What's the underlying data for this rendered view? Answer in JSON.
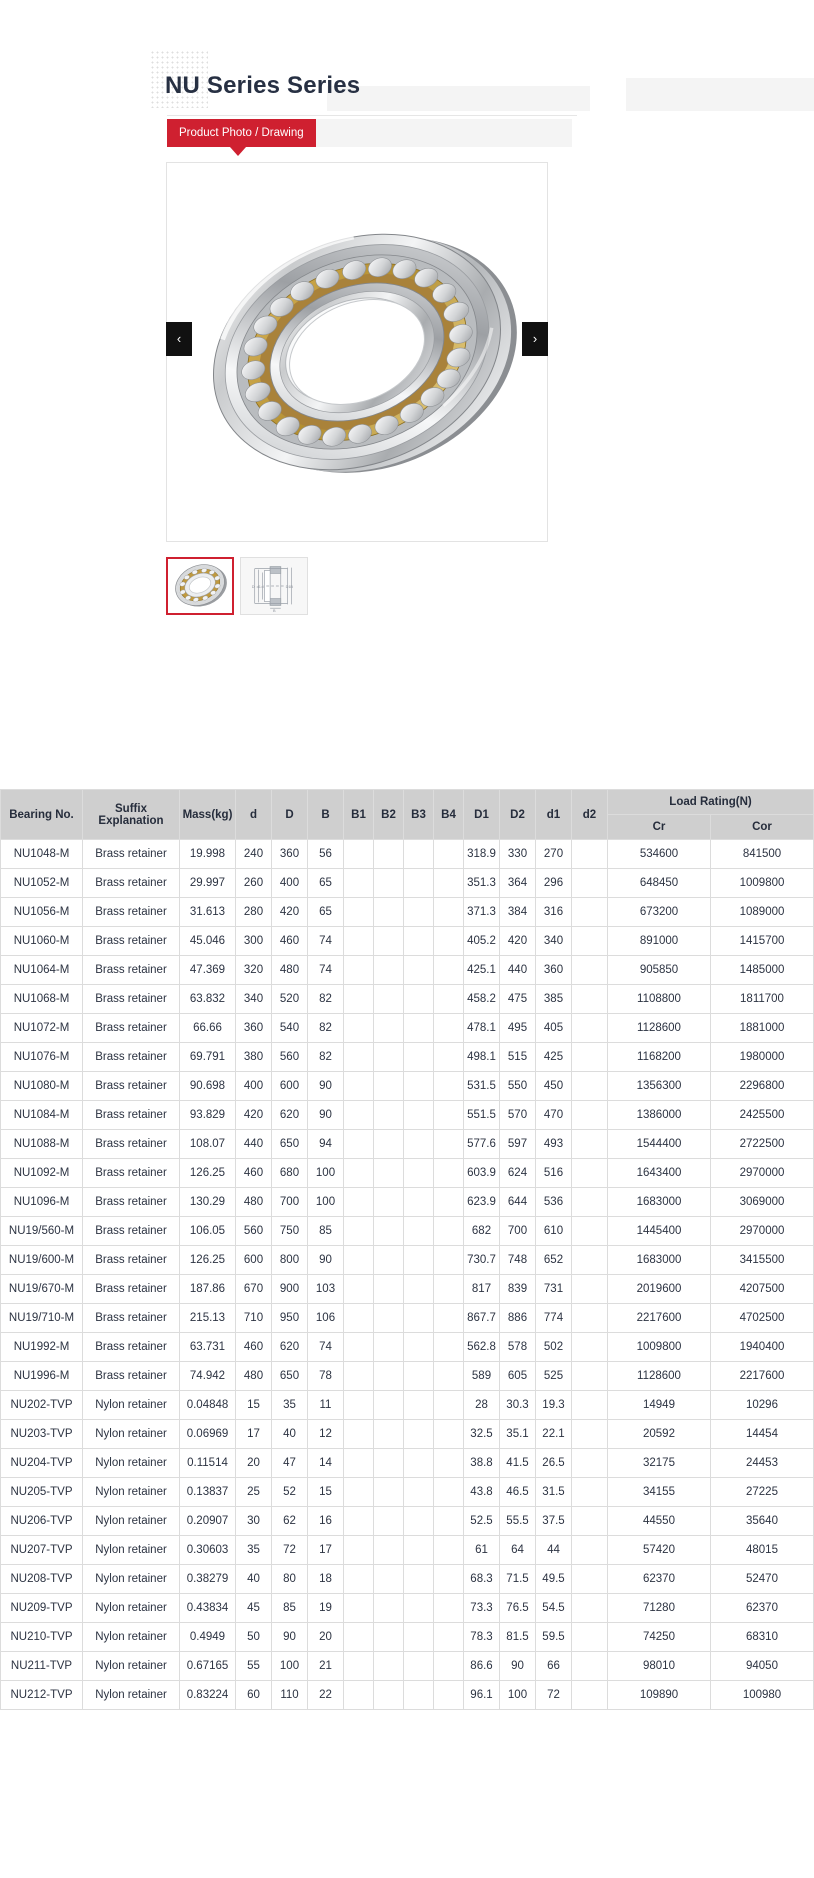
{
  "header": {
    "title": "NU Series Series",
    "tab_label": "Product Photo / Drawing"
  },
  "gallery": {
    "prev_label": "‹",
    "next_label": "›",
    "thumbs": [
      {
        "name": "product-photo-thumbnail",
        "selected": true
      },
      {
        "name": "technical-drawing-thumbnail",
        "selected": false
      }
    ]
  },
  "colors": {
    "accent": "#cf2030",
    "header_bg": "#cfcfcf",
    "text": "#2c3342",
    "border": "#dcdcdc"
  },
  "table": {
    "group_header": "Load Rating(N)",
    "columns": [
      "Bearing No.",
      "Suffix Explanation",
      "Mass(kg)",
      "d",
      "D",
      "B",
      "B1",
      "B2",
      "B3",
      "B4",
      "D1",
      "D2",
      "d1",
      "d2"
    ],
    "load_columns": [
      "Cr",
      "Cor"
    ],
    "rows": [
      [
        "NU1048-M",
        "Brass retainer",
        "19.998",
        "240",
        "360",
        "56",
        "",
        "",
        "",
        "",
        "318.9",
        "330",
        "270",
        "",
        "534600",
        "841500"
      ],
      [
        "NU1052-M",
        "Brass retainer",
        "29.997",
        "260",
        "400",
        "65",
        "",
        "",
        "",
        "",
        "351.3",
        "364",
        "296",
        "",
        "648450",
        "1009800"
      ],
      [
        "NU1056-M",
        "Brass retainer",
        "31.613",
        "280",
        "420",
        "65",
        "",
        "",
        "",
        "",
        "371.3",
        "384",
        "316",
        "",
        "673200",
        "1089000"
      ],
      [
        "NU1060-M",
        "Brass retainer",
        "45.046",
        "300",
        "460",
        "74",
        "",
        "",
        "",
        "",
        "405.2",
        "420",
        "340",
        "",
        "891000",
        "1415700"
      ],
      [
        "NU1064-M",
        "Brass retainer",
        "47.369",
        "320",
        "480",
        "74",
        "",
        "",
        "",
        "",
        "425.1",
        "440",
        "360",
        "",
        "905850",
        "1485000"
      ],
      [
        "NU1068-M",
        "Brass retainer",
        "63.832",
        "340",
        "520",
        "82",
        "",
        "",
        "",
        "",
        "458.2",
        "475",
        "385",
        "",
        "1108800",
        "1811700"
      ],
      [
        "NU1072-M",
        "Brass retainer",
        "66.66",
        "360",
        "540",
        "82",
        "",
        "",
        "",
        "",
        "478.1",
        "495",
        "405",
        "",
        "1128600",
        "1881000"
      ],
      [
        "NU1076-M",
        "Brass retainer",
        "69.791",
        "380",
        "560",
        "82",
        "",
        "",
        "",
        "",
        "498.1",
        "515",
        "425",
        "",
        "1168200",
        "1980000"
      ],
      [
        "NU1080-M",
        "Brass retainer",
        "90.698",
        "400",
        "600",
        "90",
        "",
        "",
        "",
        "",
        "531.5",
        "550",
        "450",
        "",
        "1356300",
        "2296800"
      ],
      [
        "NU1084-M",
        "Brass retainer",
        "93.829",
        "420",
        "620",
        "90",
        "",
        "",
        "",
        "",
        "551.5",
        "570",
        "470",
        "",
        "1386000",
        "2425500"
      ],
      [
        "NU1088-M",
        "Brass retainer",
        "108.07",
        "440",
        "650",
        "94",
        "",
        "",
        "",
        "",
        "577.6",
        "597",
        "493",
        "",
        "1544400",
        "2722500"
      ],
      [
        "NU1092-M",
        "Brass retainer",
        "126.25",
        "460",
        "680",
        "100",
        "",
        "",
        "",
        "",
        "603.9",
        "624",
        "516",
        "",
        "1643400",
        "2970000"
      ],
      [
        "NU1096-M",
        "Brass retainer",
        "130.29",
        "480",
        "700",
        "100",
        "",
        "",
        "",
        "",
        "623.9",
        "644",
        "536",
        "",
        "1683000",
        "3069000"
      ],
      [
        "NU19/560-M",
        "Brass retainer",
        "106.05",
        "560",
        "750",
        "85",
        "",
        "",
        "",
        "",
        "682",
        "700",
        "610",
        "",
        "1445400",
        "2970000"
      ],
      [
        "NU19/600-M",
        "Brass retainer",
        "126.25",
        "600",
        "800",
        "90",
        "",
        "",
        "",
        "",
        "730.7",
        "748",
        "652",
        "",
        "1683000",
        "3415500"
      ],
      [
        "NU19/670-M",
        "Brass retainer",
        "187.86",
        "670",
        "900",
        "103",
        "",
        "",
        "",
        "",
        "817",
        "839",
        "731",
        "",
        "2019600",
        "4207500"
      ],
      [
        "NU19/710-M",
        "Brass retainer",
        "215.13",
        "710",
        "950",
        "106",
        "",
        "",
        "",
        "",
        "867.7",
        "886",
        "774",
        "",
        "2217600",
        "4702500"
      ],
      [
        "NU1992-M",
        "Brass retainer",
        "63.731",
        "460",
        "620",
        "74",
        "",
        "",
        "",
        "",
        "562.8",
        "578",
        "502",
        "",
        "1009800",
        "1940400"
      ],
      [
        "NU1996-M",
        "Brass retainer",
        "74.942",
        "480",
        "650",
        "78",
        "",
        "",
        "",
        "",
        "589",
        "605",
        "525",
        "",
        "1128600",
        "2217600"
      ],
      [
        "NU202-TVP",
        "Nylon retainer",
        "0.04848",
        "15",
        "35",
        "11",
        "",
        "",
        "",
        "",
        "28",
        "30.3",
        "19.3",
        "",
        "14949",
        "10296"
      ],
      [
        "NU203-TVP",
        "Nylon retainer",
        "0.06969",
        "17",
        "40",
        "12",
        "",
        "",
        "",
        "",
        "32.5",
        "35.1",
        "22.1",
        "",
        "20592",
        "14454"
      ],
      [
        "NU204-TVP",
        "Nylon retainer",
        "0.11514",
        "20",
        "47",
        "14",
        "",
        "",
        "",
        "",
        "38.8",
        "41.5",
        "26.5",
        "",
        "32175",
        "24453"
      ],
      [
        "NU205-TVP",
        "Nylon retainer",
        "0.13837",
        "25",
        "52",
        "15",
        "",
        "",
        "",
        "",
        "43.8",
        "46.5",
        "31.5",
        "",
        "34155",
        "27225"
      ],
      [
        "NU206-TVP",
        "Nylon retainer",
        "0.20907",
        "30",
        "62",
        "16",
        "",
        "",
        "",
        "",
        "52.5",
        "55.5",
        "37.5",
        "",
        "44550",
        "35640"
      ],
      [
        "NU207-TVP",
        "Nylon retainer",
        "0.30603",
        "35",
        "72",
        "17",
        "",
        "",
        "",
        "",
        "61",
        "64",
        "44",
        "",
        "57420",
        "48015"
      ],
      [
        "NU208-TVP",
        "Nylon retainer",
        "0.38279",
        "40",
        "80",
        "18",
        "",
        "",
        "",
        "",
        "68.3",
        "71.5",
        "49.5",
        "",
        "62370",
        "52470"
      ],
      [
        "NU209-TVP",
        "Nylon retainer",
        "0.43834",
        "45",
        "85",
        "19",
        "",
        "",
        "",
        "",
        "73.3",
        "76.5",
        "54.5",
        "",
        "71280",
        "62370"
      ],
      [
        "NU210-TVP",
        "Nylon retainer",
        "0.4949",
        "50",
        "90",
        "20",
        "",
        "",
        "",
        "",
        "78.3",
        "81.5",
        "59.5",
        "",
        "74250",
        "68310"
      ],
      [
        "NU211-TVP",
        "Nylon retainer",
        "0.67165",
        "55",
        "100",
        "21",
        "",
        "",
        "",
        "",
        "86.6",
        "90",
        "66",
        "",
        "98010",
        "94050"
      ],
      [
        "NU212-TVP",
        "Nylon retainer",
        "0.83224",
        "60",
        "110",
        "22",
        "",
        "",
        "",
        "",
        "96.1",
        "100",
        "72",
        "",
        "109890",
        "100980"
      ]
    ]
  }
}
